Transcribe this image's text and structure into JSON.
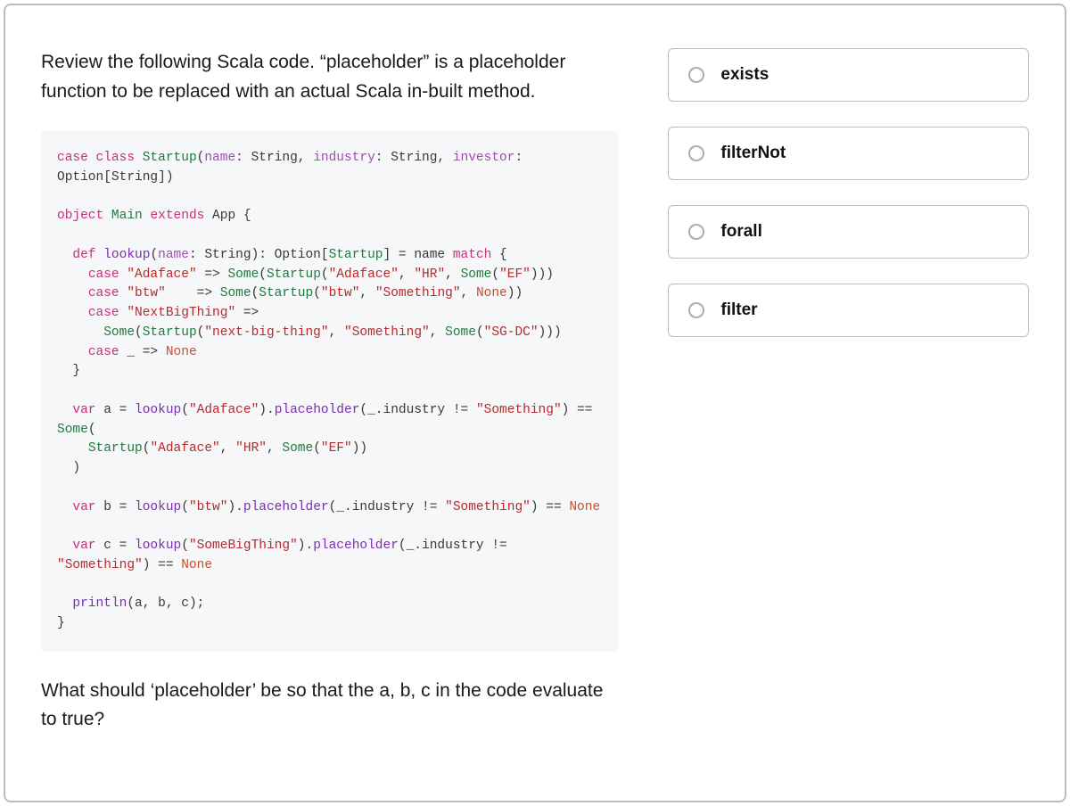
{
  "question": {
    "intro": "Review the following Scala code. “placeholder” is a placeholder function to be replaced with an actual Scala in-built method.",
    "followup": "What should ‘placeholder’ be so that the a, b, c in the code evaluate to true?"
  },
  "code": {
    "tokens": [
      {
        "t": "k",
        "v": "case"
      },
      {
        "t": "",
        "v": " "
      },
      {
        "t": "k",
        "v": "class"
      },
      {
        "t": "",
        "v": " "
      },
      {
        "t": "t",
        "v": "Startup"
      },
      {
        "t": "",
        "v": "("
      },
      {
        "t": "p",
        "v": "name"
      },
      {
        "t": "",
        "v": ": String, "
      },
      {
        "t": "p",
        "v": "industry"
      },
      {
        "t": "",
        "v": ": String, "
      },
      {
        "t": "p",
        "v": "investor"
      },
      {
        "t": "",
        "v": ": Option[String])"
      },
      {
        "t": "br"
      },
      {
        "t": "br"
      },
      {
        "t": "k",
        "v": "object"
      },
      {
        "t": "",
        "v": " "
      },
      {
        "t": "t",
        "v": "Main"
      },
      {
        "t": "",
        "v": " "
      },
      {
        "t": "k",
        "v": "extends"
      },
      {
        "t": "",
        "v": " App {"
      },
      {
        "t": "br"
      },
      {
        "t": "br"
      },
      {
        "t": "",
        "v": "  "
      },
      {
        "t": "k",
        "v": "def"
      },
      {
        "t": "",
        "v": " "
      },
      {
        "t": "f",
        "v": "lookup"
      },
      {
        "t": "",
        "v": "("
      },
      {
        "t": "p",
        "v": "name"
      },
      {
        "t": "",
        "v": ": String): Option["
      },
      {
        "t": "t",
        "v": "Startup"
      },
      {
        "t": "",
        "v": "] = name "
      },
      {
        "t": "k",
        "v": "match"
      },
      {
        "t": "",
        "v": " {"
      },
      {
        "t": "br"
      },
      {
        "t": "",
        "v": "    "
      },
      {
        "t": "k",
        "v": "case"
      },
      {
        "t": "",
        "v": " "
      },
      {
        "t": "s",
        "v": "\"Adaface\""
      },
      {
        "t": "",
        "v": " => "
      },
      {
        "t": "t",
        "v": "Some"
      },
      {
        "t": "",
        "v": "("
      },
      {
        "t": "t",
        "v": "Startup"
      },
      {
        "t": "",
        "v": "("
      },
      {
        "t": "s",
        "v": "\"Adaface\""
      },
      {
        "t": "",
        "v": ", "
      },
      {
        "t": "s",
        "v": "\"HR\""
      },
      {
        "t": "",
        "v": ", "
      },
      {
        "t": "t",
        "v": "Some"
      },
      {
        "t": "",
        "v": "("
      },
      {
        "t": "s",
        "v": "\"EF\""
      },
      {
        "t": "",
        "v": ")))"
      },
      {
        "t": "br"
      },
      {
        "t": "",
        "v": "    "
      },
      {
        "t": "k",
        "v": "case"
      },
      {
        "t": "",
        "v": " "
      },
      {
        "t": "s",
        "v": "\"btw\""
      },
      {
        "t": "",
        "v": "    => "
      },
      {
        "t": "t",
        "v": "Some"
      },
      {
        "t": "",
        "v": "("
      },
      {
        "t": "t",
        "v": "Startup"
      },
      {
        "t": "",
        "v": "("
      },
      {
        "t": "s",
        "v": "\"btw\""
      },
      {
        "t": "",
        "v": ", "
      },
      {
        "t": "s",
        "v": "\"Something\""
      },
      {
        "t": "",
        "v": ", "
      },
      {
        "t": "n",
        "v": "None"
      },
      {
        "t": "",
        "v": "))"
      },
      {
        "t": "br"
      },
      {
        "t": "",
        "v": "    "
      },
      {
        "t": "k",
        "v": "case"
      },
      {
        "t": "",
        "v": " "
      },
      {
        "t": "s",
        "v": "\"NextBigThing\""
      },
      {
        "t": "",
        "v": " =>"
      },
      {
        "t": "br"
      },
      {
        "t": "",
        "v": "      "
      },
      {
        "t": "t",
        "v": "Some"
      },
      {
        "t": "",
        "v": "("
      },
      {
        "t": "t",
        "v": "Startup"
      },
      {
        "t": "",
        "v": "("
      },
      {
        "t": "s",
        "v": "\"next-big-thing\""
      },
      {
        "t": "",
        "v": ", "
      },
      {
        "t": "s",
        "v": "\"Something\""
      },
      {
        "t": "",
        "v": ", "
      },
      {
        "t": "t",
        "v": "Some"
      },
      {
        "t": "",
        "v": "("
      },
      {
        "t": "s",
        "v": "\"SG-DC\""
      },
      {
        "t": "",
        "v": ")))"
      },
      {
        "t": "br"
      },
      {
        "t": "",
        "v": "    "
      },
      {
        "t": "k",
        "v": "case"
      },
      {
        "t": "",
        "v": " _ => "
      },
      {
        "t": "n",
        "v": "None"
      },
      {
        "t": "br"
      },
      {
        "t": "",
        "v": "  }"
      },
      {
        "t": "br"
      },
      {
        "t": "br"
      },
      {
        "t": "",
        "v": "  "
      },
      {
        "t": "k",
        "v": "var"
      },
      {
        "t": "",
        "v": " a = "
      },
      {
        "t": "f",
        "v": "lookup"
      },
      {
        "t": "",
        "v": "("
      },
      {
        "t": "s",
        "v": "\"Adaface\""
      },
      {
        "t": "",
        "v": ")."
      },
      {
        "t": "f",
        "v": "placeholder"
      },
      {
        "t": "",
        "v": "(_.industry != "
      },
      {
        "t": "s",
        "v": "\"Something\""
      },
      {
        "t": "",
        "v": ") == "
      },
      {
        "t": "t",
        "v": "Some"
      },
      {
        "t": "",
        "v": "("
      },
      {
        "t": "br"
      },
      {
        "t": "",
        "v": "    "
      },
      {
        "t": "t",
        "v": "Startup"
      },
      {
        "t": "",
        "v": "("
      },
      {
        "t": "s",
        "v": "\"Adaface\""
      },
      {
        "t": "",
        "v": ", "
      },
      {
        "t": "s",
        "v": "\"HR\""
      },
      {
        "t": "",
        "v": ", "
      },
      {
        "t": "t",
        "v": "Some"
      },
      {
        "t": "",
        "v": "("
      },
      {
        "t": "s",
        "v": "\"EF\""
      },
      {
        "t": "",
        "v": "))"
      },
      {
        "t": "br"
      },
      {
        "t": "",
        "v": "  )"
      },
      {
        "t": "br"
      },
      {
        "t": "br"
      },
      {
        "t": "",
        "v": "  "
      },
      {
        "t": "k",
        "v": "var"
      },
      {
        "t": "",
        "v": " b = "
      },
      {
        "t": "f",
        "v": "lookup"
      },
      {
        "t": "",
        "v": "("
      },
      {
        "t": "s",
        "v": "\"btw\""
      },
      {
        "t": "",
        "v": ")."
      },
      {
        "t": "f",
        "v": "placeholder"
      },
      {
        "t": "",
        "v": "(_.industry != "
      },
      {
        "t": "s",
        "v": "\"Something\""
      },
      {
        "t": "",
        "v": ") == "
      },
      {
        "t": "n",
        "v": "None"
      },
      {
        "t": "br"
      },
      {
        "t": "br"
      },
      {
        "t": "",
        "v": "  "
      },
      {
        "t": "k",
        "v": "var"
      },
      {
        "t": "",
        "v": " c = "
      },
      {
        "t": "f",
        "v": "lookup"
      },
      {
        "t": "",
        "v": "("
      },
      {
        "t": "s",
        "v": "\"SomeBigThing\""
      },
      {
        "t": "",
        "v": ")."
      },
      {
        "t": "f",
        "v": "placeholder"
      },
      {
        "t": "",
        "v": "(_.industry != "
      },
      {
        "t": "s",
        "v": "\"Something\""
      },
      {
        "t": "",
        "v": ") == "
      },
      {
        "t": "n",
        "v": "None"
      },
      {
        "t": "br"
      },
      {
        "t": "br"
      },
      {
        "t": "",
        "v": "  "
      },
      {
        "t": "f",
        "v": "println"
      },
      {
        "t": "",
        "v": "(a, b, c);"
      },
      {
        "t": "br"
      },
      {
        "t": "",
        "v": "}"
      }
    ]
  },
  "options": [
    {
      "label": "exists"
    },
    {
      "label": "filterNot"
    },
    {
      "label": "forall"
    },
    {
      "label": "filter"
    }
  ]
}
